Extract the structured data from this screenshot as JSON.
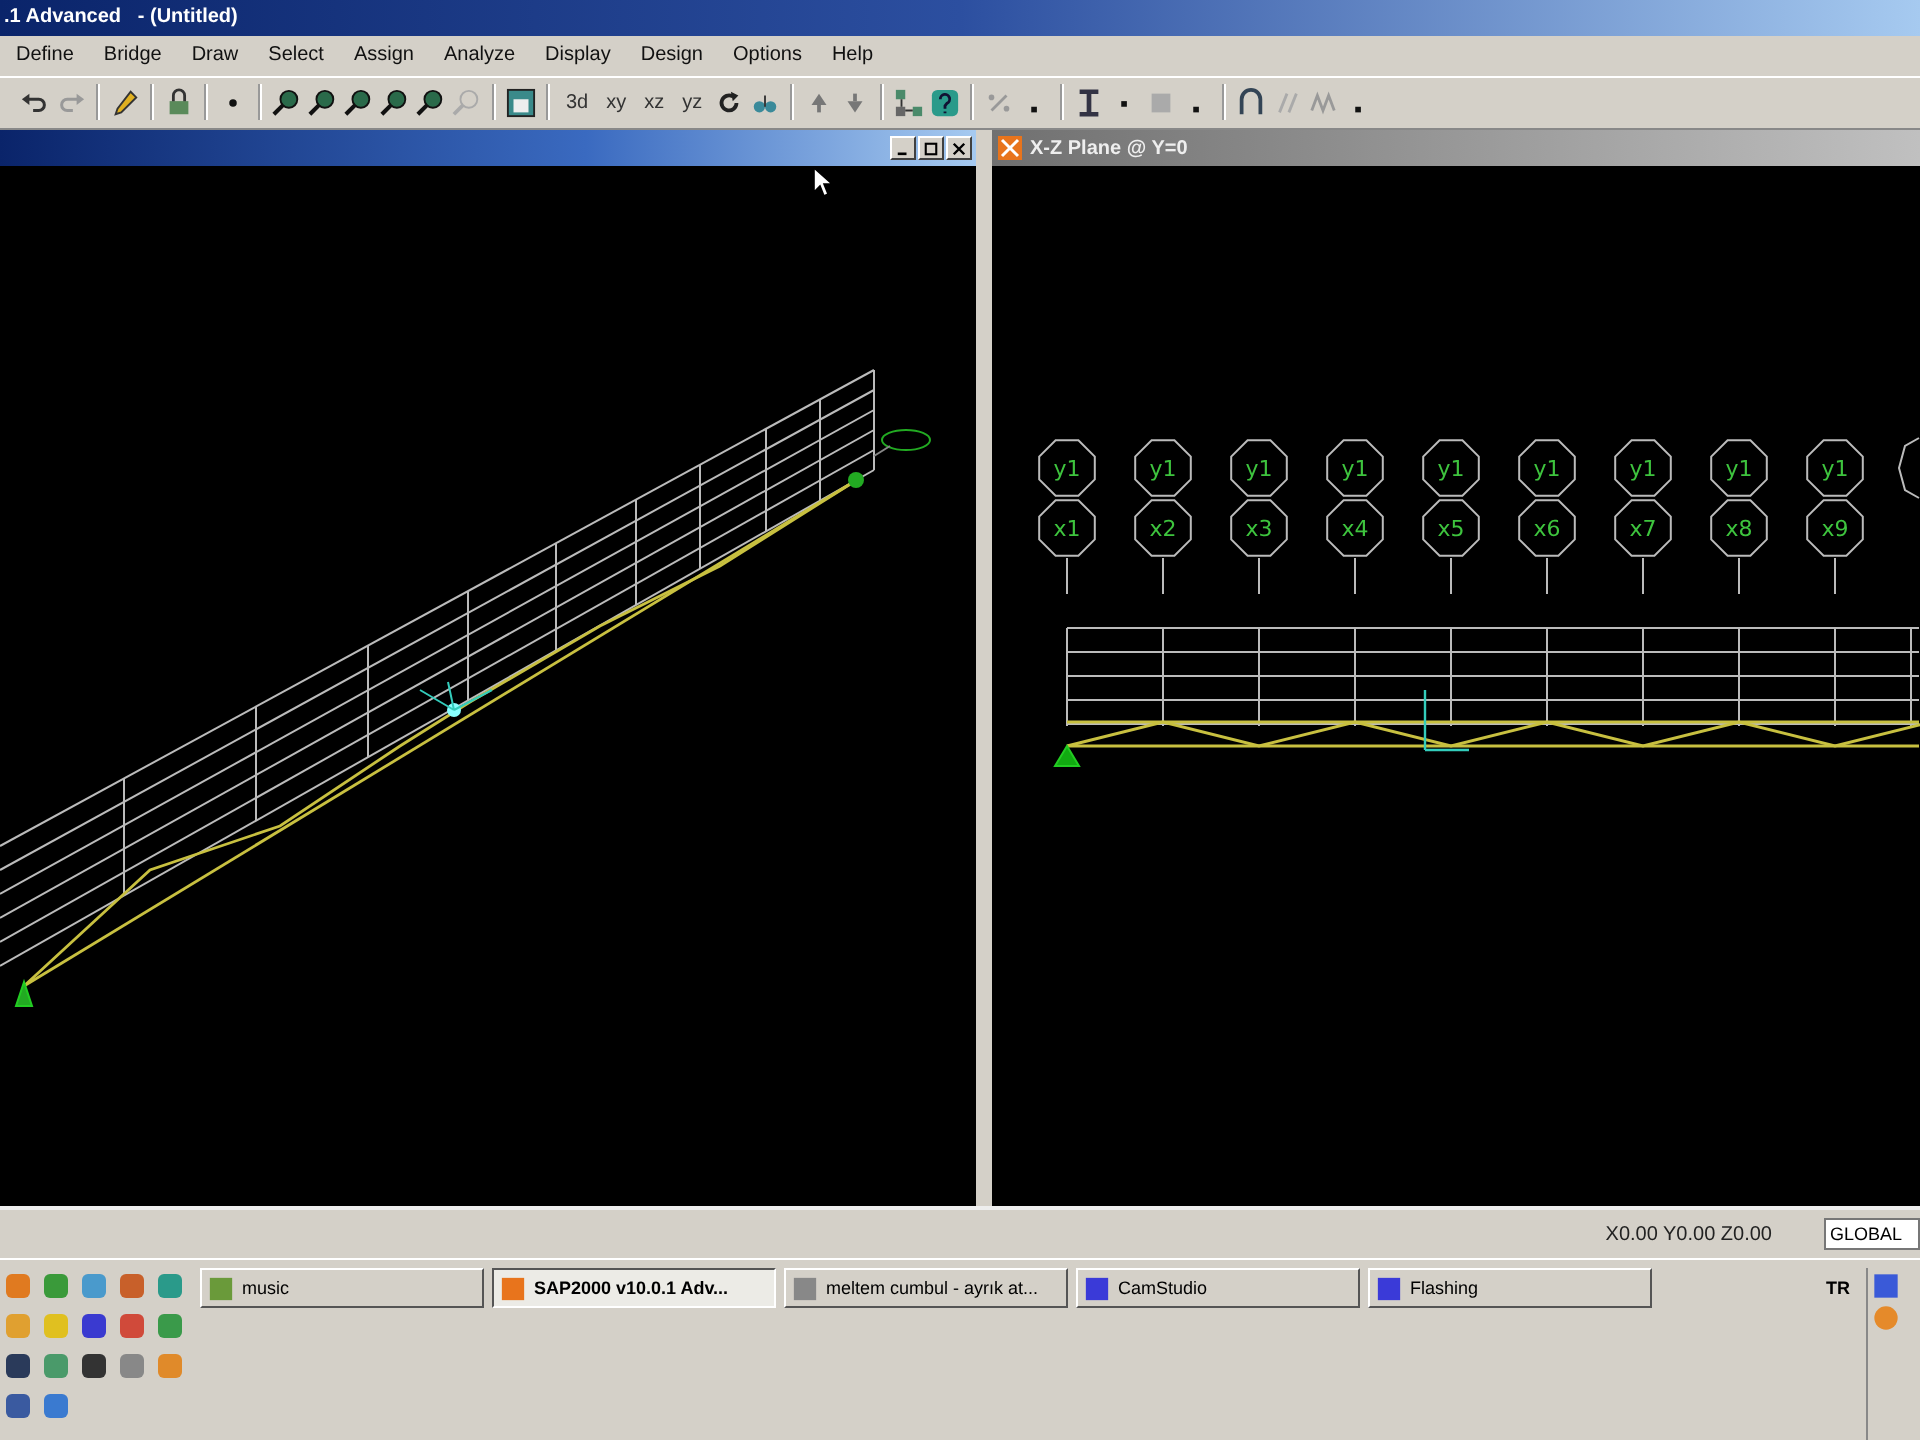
{
  "window": {
    "title": ".1 Advanced   - (Untitled)"
  },
  "menu": [
    "Define",
    "Bridge",
    "Draw",
    "Select",
    "Assign",
    "Analyze",
    "Display",
    "Design",
    "Options",
    "Help"
  ],
  "toolbar": {
    "view_buttons": [
      "3d",
      "xy",
      "xz",
      "yz"
    ]
  },
  "right_pane": {
    "title": "X-Z Plane @ Y=0",
    "grid_bubbles": [
      {
        "top": "y1",
        "bottom": "x1"
      },
      {
        "top": "y1",
        "bottom": "x2"
      },
      {
        "top": "y1",
        "bottom": "x3"
      },
      {
        "top": "y1",
        "bottom": "x4"
      },
      {
        "top": "y1",
        "bottom": "x5"
      },
      {
        "top": "y1",
        "bottom": "x6"
      },
      {
        "top": "y1",
        "bottom": "x7"
      },
      {
        "top": "y1",
        "bottom": "x8"
      },
      {
        "top": "y1",
        "bottom": "x9"
      }
    ]
  },
  "status_bar": {
    "coordinates": "X0.00 Y0.00 Z0.00",
    "coordinate_system": "GLOBAL"
  },
  "taskbar": {
    "tasks": [
      {
        "label": "music",
        "selected": false
      },
      {
        "label": "SAP2000 v10.0.1  Adv...",
        "selected": true
      },
      {
        "label": "meltem cumbul - ayrık at...",
        "selected": false
      },
      {
        "label": "CamStudio",
        "selected": false
      },
      {
        "label": "Flashing",
        "selected": false
      }
    ],
    "language": "TR"
  }
}
